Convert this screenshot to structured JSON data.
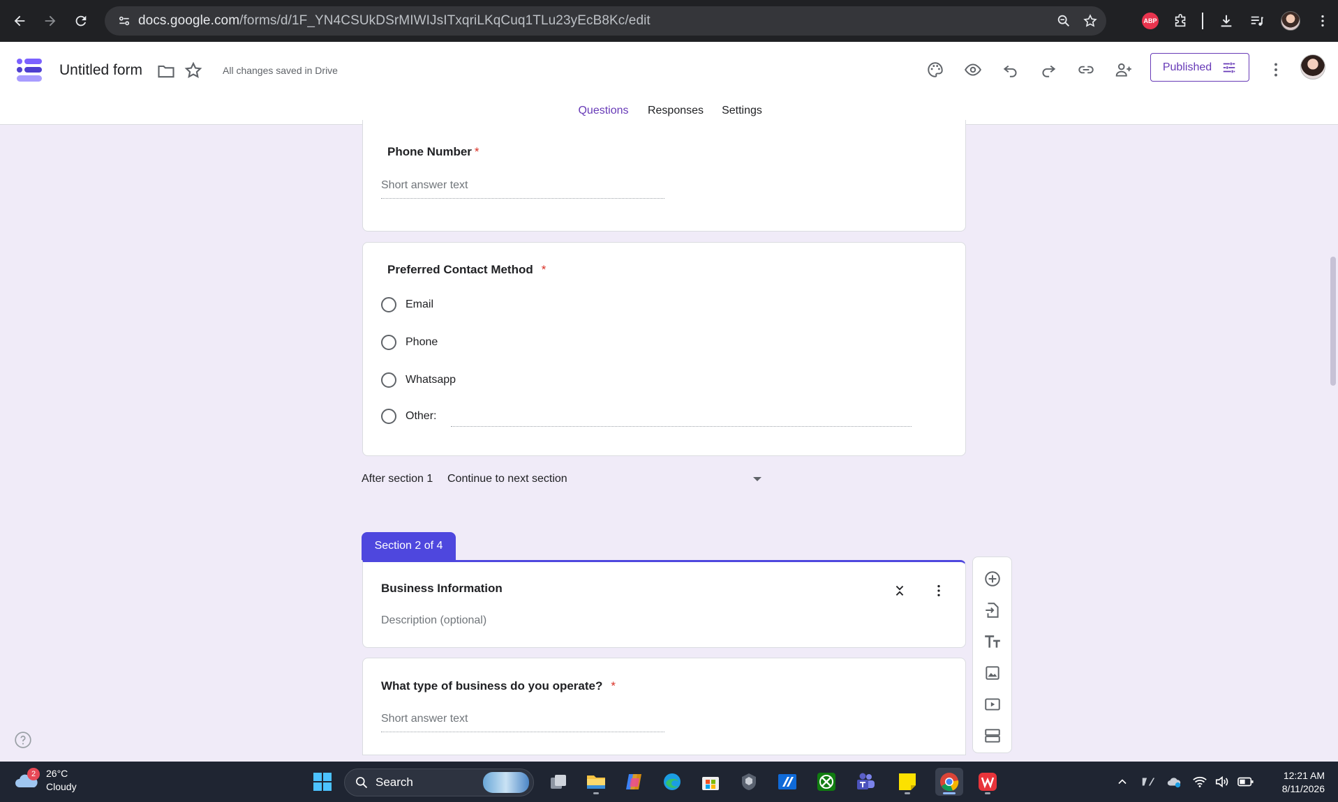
{
  "browser": {
    "url_host": "docs.google.com",
    "url_path": "/forms/d/1F_YN4CSUkDSrMIWIJsITxqriLKqCuq1TLu23yEcB8Kc/edit",
    "abp_label": "ABP"
  },
  "header": {
    "form_title": "Untitled form",
    "save_status": "All changes saved in Drive",
    "published_label": "Published"
  },
  "tabs": [
    {
      "label": "Questions",
      "active": true
    },
    {
      "label": "Responses",
      "active": false
    },
    {
      "label": "Settings",
      "active": false
    }
  ],
  "questions": {
    "phone": {
      "title": "Phone Number",
      "required_mark": "*",
      "placeholder": "Short answer text"
    },
    "contact": {
      "title": "Preferred Contact Method",
      "required_mark": "*",
      "options": [
        "Email",
        "Phone",
        "Whatsapp",
        "Other:"
      ]
    }
  },
  "after_section": {
    "label": "After section 1",
    "value": "Continue to next section"
  },
  "section2": {
    "badge": "Section 2 of 4",
    "title": "Business Information",
    "description_placeholder": "Description (optional)",
    "question": {
      "title": "What type of business do you operate?",
      "required_mark": "*",
      "placeholder": "Short answer text"
    }
  },
  "side_toolbar": [
    "add-question-icon",
    "import-questions-icon",
    "add-title-icon",
    "add-image-icon",
    "add-video-icon",
    "add-section-icon"
  ],
  "taskbar": {
    "weather_badge": "2",
    "temperature": "26°C",
    "condition": "Cloudy",
    "search_label": "Search",
    "time": "12:21 AM",
    "date": "8/11/2026"
  },
  "colors": {
    "accent": "#673ab7",
    "background": "#f0ebf8",
    "section_badge": "#4e47de",
    "required": "#d93025"
  }
}
